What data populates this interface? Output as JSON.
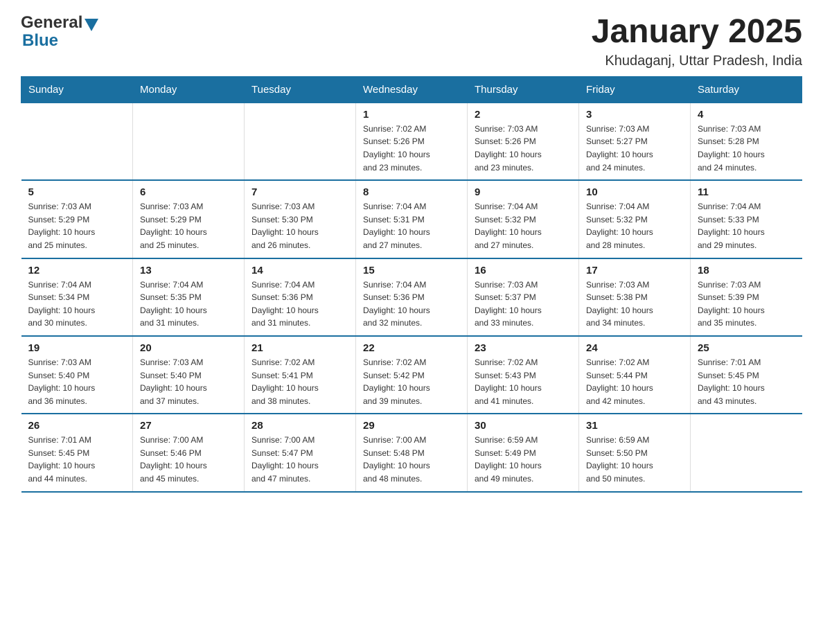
{
  "header": {
    "logo_general": "General",
    "logo_blue": "Blue",
    "month_title": "January 2025",
    "location": "Khudaganj, Uttar Pradesh, India"
  },
  "days_of_week": [
    "Sunday",
    "Monday",
    "Tuesday",
    "Wednesday",
    "Thursday",
    "Friday",
    "Saturday"
  ],
  "weeks": [
    [
      {
        "day": "",
        "info": ""
      },
      {
        "day": "",
        "info": ""
      },
      {
        "day": "",
        "info": ""
      },
      {
        "day": "1",
        "info": "Sunrise: 7:02 AM\nSunset: 5:26 PM\nDaylight: 10 hours\nand 23 minutes."
      },
      {
        "day": "2",
        "info": "Sunrise: 7:03 AM\nSunset: 5:26 PM\nDaylight: 10 hours\nand 23 minutes."
      },
      {
        "day": "3",
        "info": "Sunrise: 7:03 AM\nSunset: 5:27 PM\nDaylight: 10 hours\nand 24 minutes."
      },
      {
        "day": "4",
        "info": "Sunrise: 7:03 AM\nSunset: 5:28 PM\nDaylight: 10 hours\nand 24 minutes."
      }
    ],
    [
      {
        "day": "5",
        "info": "Sunrise: 7:03 AM\nSunset: 5:29 PM\nDaylight: 10 hours\nand 25 minutes."
      },
      {
        "day": "6",
        "info": "Sunrise: 7:03 AM\nSunset: 5:29 PM\nDaylight: 10 hours\nand 25 minutes."
      },
      {
        "day": "7",
        "info": "Sunrise: 7:03 AM\nSunset: 5:30 PM\nDaylight: 10 hours\nand 26 minutes."
      },
      {
        "day": "8",
        "info": "Sunrise: 7:04 AM\nSunset: 5:31 PM\nDaylight: 10 hours\nand 27 minutes."
      },
      {
        "day": "9",
        "info": "Sunrise: 7:04 AM\nSunset: 5:32 PM\nDaylight: 10 hours\nand 27 minutes."
      },
      {
        "day": "10",
        "info": "Sunrise: 7:04 AM\nSunset: 5:32 PM\nDaylight: 10 hours\nand 28 minutes."
      },
      {
        "day": "11",
        "info": "Sunrise: 7:04 AM\nSunset: 5:33 PM\nDaylight: 10 hours\nand 29 minutes."
      }
    ],
    [
      {
        "day": "12",
        "info": "Sunrise: 7:04 AM\nSunset: 5:34 PM\nDaylight: 10 hours\nand 30 minutes."
      },
      {
        "day": "13",
        "info": "Sunrise: 7:04 AM\nSunset: 5:35 PM\nDaylight: 10 hours\nand 31 minutes."
      },
      {
        "day": "14",
        "info": "Sunrise: 7:04 AM\nSunset: 5:36 PM\nDaylight: 10 hours\nand 31 minutes."
      },
      {
        "day": "15",
        "info": "Sunrise: 7:04 AM\nSunset: 5:36 PM\nDaylight: 10 hours\nand 32 minutes."
      },
      {
        "day": "16",
        "info": "Sunrise: 7:03 AM\nSunset: 5:37 PM\nDaylight: 10 hours\nand 33 minutes."
      },
      {
        "day": "17",
        "info": "Sunrise: 7:03 AM\nSunset: 5:38 PM\nDaylight: 10 hours\nand 34 minutes."
      },
      {
        "day": "18",
        "info": "Sunrise: 7:03 AM\nSunset: 5:39 PM\nDaylight: 10 hours\nand 35 minutes."
      }
    ],
    [
      {
        "day": "19",
        "info": "Sunrise: 7:03 AM\nSunset: 5:40 PM\nDaylight: 10 hours\nand 36 minutes."
      },
      {
        "day": "20",
        "info": "Sunrise: 7:03 AM\nSunset: 5:40 PM\nDaylight: 10 hours\nand 37 minutes."
      },
      {
        "day": "21",
        "info": "Sunrise: 7:02 AM\nSunset: 5:41 PM\nDaylight: 10 hours\nand 38 minutes."
      },
      {
        "day": "22",
        "info": "Sunrise: 7:02 AM\nSunset: 5:42 PM\nDaylight: 10 hours\nand 39 minutes."
      },
      {
        "day": "23",
        "info": "Sunrise: 7:02 AM\nSunset: 5:43 PM\nDaylight: 10 hours\nand 41 minutes."
      },
      {
        "day": "24",
        "info": "Sunrise: 7:02 AM\nSunset: 5:44 PM\nDaylight: 10 hours\nand 42 minutes."
      },
      {
        "day": "25",
        "info": "Sunrise: 7:01 AM\nSunset: 5:45 PM\nDaylight: 10 hours\nand 43 minutes."
      }
    ],
    [
      {
        "day": "26",
        "info": "Sunrise: 7:01 AM\nSunset: 5:45 PM\nDaylight: 10 hours\nand 44 minutes."
      },
      {
        "day": "27",
        "info": "Sunrise: 7:00 AM\nSunset: 5:46 PM\nDaylight: 10 hours\nand 45 minutes."
      },
      {
        "day": "28",
        "info": "Sunrise: 7:00 AM\nSunset: 5:47 PM\nDaylight: 10 hours\nand 47 minutes."
      },
      {
        "day": "29",
        "info": "Sunrise: 7:00 AM\nSunset: 5:48 PM\nDaylight: 10 hours\nand 48 minutes."
      },
      {
        "day": "30",
        "info": "Sunrise: 6:59 AM\nSunset: 5:49 PM\nDaylight: 10 hours\nand 49 minutes."
      },
      {
        "day": "31",
        "info": "Sunrise: 6:59 AM\nSunset: 5:50 PM\nDaylight: 10 hours\nand 50 minutes."
      },
      {
        "day": "",
        "info": ""
      }
    ]
  ]
}
